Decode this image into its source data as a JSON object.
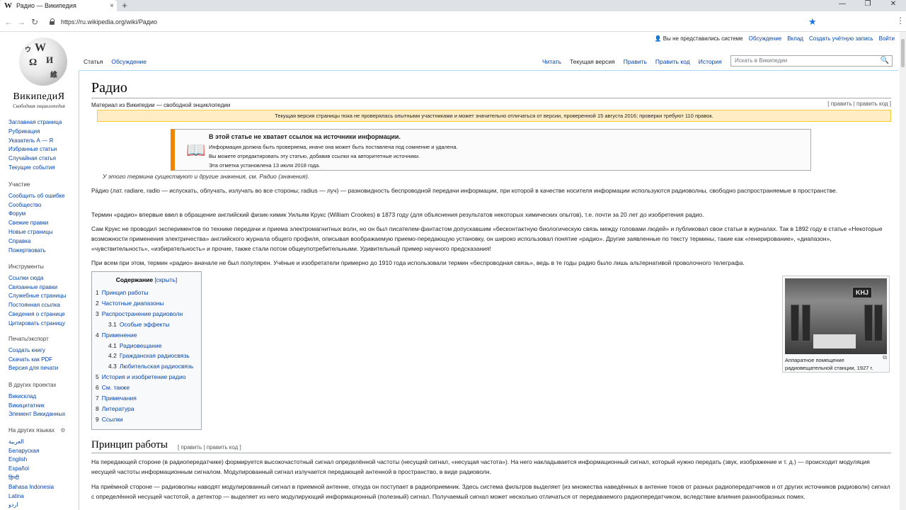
{
  "browser": {
    "tab_title": "Радио — Википедия",
    "tab_logo": "W",
    "tab_close": "×",
    "new_tab": "+",
    "url": "https://ru.wikipedia.org/wiki/Радио",
    "back": "←",
    "forward": "→",
    "reload": "↻",
    "bookmark_star": "★",
    "menu_dots": "⋮",
    "win_min": "—",
    "win_restore": "❐",
    "win_close": "✕"
  },
  "logo": {
    "wordmark": "ВикипедиЯ",
    "tagline": "Свободная энциклопедия",
    "glyphs": [
      "W",
      "Ω",
      "И",
      "ウ",
      "維"
    ]
  },
  "personal": {
    "user_icon": "👤",
    "items": [
      "Вы не представились системе",
      "Обсуждение",
      "Вклад",
      "Создать учётную запись",
      "Войти"
    ]
  },
  "tabs": {
    "left": [
      "Статья",
      "Обсуждение"
    ],
    "right": [
      "Читать",
      "Текущая версия",
      "Править",
      "Править код",
      "История"
    ]
  },
  "search": {
    "placeholder": "Искать в Википедии",
    "icon": "🔍"
  },
  "sidebar": {
    "main": [
      "Заглавная страница",
      "Рубрикация",
      "Указатель А — Я",
      "Избранные статьи",
      "Случайная статья",
      "Текущие события"
    ],
    "participation_heading": "Участие",
    "participation": [
      "Сообщить об ошибке",
      "Сообщество",
      "Форум",
      "Свежие правки",
      "Новые страницы",
      "Справка",
      "Пожертвовать"
    ],
    "tools_heading": "Инструменты",
    "tools": [
      "Ссылки сюда",
      "Связанные правки",
      "Служебные страницы",
      "Постоянная ссылка",
      "Сведения о странице",
      "Цитировать страницу"
    ],
    "print_heading": "Печать/экспорт",
    "print": [
      "Создать книгу",
      "Скачать как PDF",
      "Версия для печати"
    ],
    "projects_heading": "В других проектах",
    "projects": [
      "Викисклад",
      "Викицитатник",
      "Элемент Викиданных"
    ],
    "languages_heading": "На других языках",
    "languages": [
      "العربية",
      "Беларуская",
      "English",
      "Español",
      "हिन्दी",
      "Bahasa Indonesia",
      "Latina",
      "اردو"
    ]
  },
  "article": {
    "title": "Радио",
    "from": "Материал из Википедии — свободной энциклопедии",
    "edit_links": "[ править | править код ]",
    "flagged": "Текущая версия страницы пока не проверялась опытными участниками и может значительно отличаться от версии, проверенной 15 августа 2016; проверки требуют 110 правок.",
    "ambox": {
      "title": "В этой статье не хватает ссылок на источники информации.",
      "line1": "Информация должна быть проверяема, иначе она может быть поставлена под сомнение и удалена.",
      "line2": "Вы можете отредактировать эту статью, добавив ссылки на авторитетные источники.",
      "line3": "Эта отметка установлена 13 июля 2018 года.",
      "icon": "📖"
    },
    "dablink": "У этого термина существуют и другие значения, см. Радио (значения).",
    "p1": "Ра́дио (лат. radiare, radio — испускать, облучать, излучать во все стороны; radius — луч) — разновидность беспроводной передачи информации, при которой в качестве носителя информации используются радиоволны, свободно распространяемые в пространстве.",
    "p2": "Термин «радио» впервые ввел в обращение английский физик-химик Уильям Крукс (William Crookes) в 1873 году (для объяснения результатов некоторых химических опытов), т.е. почти за 20 лет до изобретения радио.",
    "p3": "Сам Крукс не проводил экспериментов по технике передачи и приема электромагнитных волн, но он был писателем-фантастом допускавшим «бесконтактную биологическую связь между головами людей» и публиковал свои статьи в журналах. Так в 1892 году в статье «Некоторые возможности применения электричества» английского журнала общего профиля, описывая воображаемую приемо-передающую установку, он широко использовал понятие «радио». Другие заявленные по тексту термины, такие как «генерирование», «диапазон», «чувствительность», «избирательность» и прочие, также стали потом общеупотребительными. Удивительный пример научного предсказания!",
    "p4": "При всем при этом, термин «радио» вначале не был популярен. Учёные и изобретатели примерно до 1910 года использовали термин «беспроводная связь», ведь в те годы радио было лишь альтернативой проволочного телеграфа.",
    "toc": {
      "heading": "Содержание",
      "hide": "[скрыть]",
      "items": [
        {
          "n": "1",
          "t": "Принцип работы",
          "sub": false
        },
        {
          "n": "2",
          "t": "Частотные диапазоны",
          "sub": false
        },
        {
          "n": "3",
          "t": "Распространение радиоволн",
          "sub": false
        },
        {
          "n": "3.1",
          "t": "Особые эффекты",
          "sub": true
        },
        {
          "n": "4",
          "t": "Применение",
          "sub": false
        },
        {
          "n": "4.1",
          "t": "Радиовещание",
          "sub": true
        },
        {
          "n": "4.2",
          "t": "Гражданская радиосвязь",
          "sub": true
        },
        {
          "n": "4.3",
          "t": "Любительская радиосвязь",
          "sub": true
        },
        {
          "n": "5",
          "t": "История и изобретение радио",
          "sub": false
        },
        {
          "n": "6",
          "t": "См. также",
          "sub": false
        },
        {
          "n": "7",
          "t": "Примечания",
          "sub": false
        },
        {
          "n": "8",
          "t": "Литература",
          "sub": false
        },
        {
          "n": "9",
          "t": "Ссылки",
          "sub": false
        }
      ]
    },
    "thumb": {
      "sign": "KHJ",
      "caption": "Аппаратное помещение радиовещательной станции, 1927 г.",
      "enlarge_icon": "⧉"
    },
    "h2": "Принцип работы",
    "h2_edit": "[ править | править код ]",
    "p5": "На передающей стороне (в радиопередатчике) формируется высокочастотный сигнал определённой частоты (несущий сигнал, «несущая частота»). На него накладывается информационный сигнал, который нужно передать (звук, изображение и т. д.) — происходит модуляция несущей частоты информационным сигналом. Модулированный сигнал излучается передающей антенной в пространство, в виде радиоволн.",
    "p6": "На приёмной стороне — радиоволны наводят модулированный сигнал в приемной антенне, откуда он поступает в радиоприемник. Здесь система фильтров выделяет (из множества наведённых в антенне токов от разных радиопередатчиков и от других источников радиоволн) сигнал с определённой несущей частотой, а детектор — выделяет из него модулирующий информационный (полезный) сигнал. Получаемый сигнал может несколько отличаться от передаваемого радиопередатчиком, вследствие влияния разнообразных помех."
  }
}
